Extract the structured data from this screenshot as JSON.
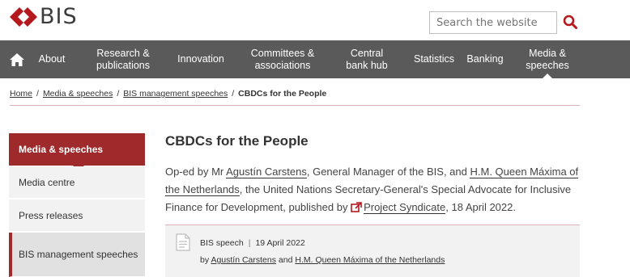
{
  "header": {
    "logo_text": "BIS",
    "brand_color": "#b4191e",
    "search_placeholder": "Search the website"
  },
  "nav": {
    "home_icon": "home-icon",
    "items": [
      {
        "label": "About"
      },
      {
        "label": "Research & publications"
      },
      {
        "label": "Innovation"
      },
      {
        "label": "Committees & associations"
      },
      {
        "label": "Central bank hub"
      },
      {
        "label": "Statistics"
      },
      {
        "label": "Banking"
      },
      {
        "label": "Media & speeches"
      }
    ],
    "active": "Media & speeches"
  },
  "breadcrumb": {
    "items": [
      "Home",
      "Media & speeches",
      "BIS management speeches"
    ],
    "current": "CBDCs for the People",
    "separator": "/"
  },
  "sidebar": {
    "heading": "Media & speeches",
    "items": [
      {
        "label": "Media centre"
      },
      {
        "label": "Press releases"
      },
      {
        "label": "BIS management speeches"
      }
    ]
  },
  "article": {
    "title": "CBDCs for the People",
    "lead_prefix": "Op-ed by Mr ",
    "author1": "Agustín Carstens",
    "lead_mid1": ", General Manager of the BIS, and ",
    "author2": "H.M. Queen Máxima of the Netherlands",
    "lead_mid2": ", the United Nations Secretary-General's Special Advocate for Inclusive Finance for Development, published by ",
    "publisher": "Project Syndicate",
    "lead_suffix": ", 18 April 2022.",
    "speech_type": "BIS speech",
    "speech_date": "19 April 2022",
    "by_label": "by",
    "by_author1": "Agustín Carstens",
    "by_and": "and",
    "by_author2": "H.M. Queen Máxima of the Netherlands"
  },
  "colors": {
    "accent": "#9e2a2b",
    "nav_bg": "#5a5a5a"
  }
}
